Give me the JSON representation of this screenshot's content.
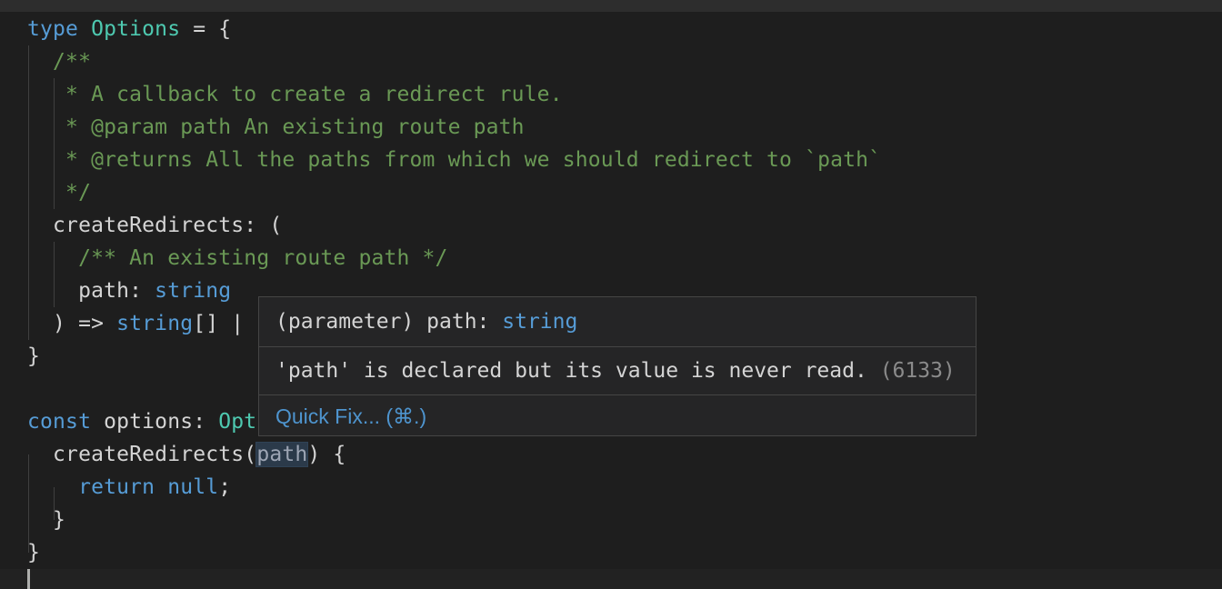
{
  "lines": [
    {
      "tokens": [
        {
          "t": "type ",
          "c": "kw"
        },
        {
          "t": "Options",
          "c": "ty"
        },
        {
          "t": " = {",
          "c": "pl"
        }
      ]
    },
    {
      "tokens": [
        {
          "t": "  /**",
          "c": "cm"
        }
      ]
    },
    {
      "tokens": [
        {
          "t": "   * A callback to create a redirect rule.",
          "c": "cm"
        }
      ]
    },
    {
      "tokens": [
        {
          "t": "   * @param path An existing route path",
          "c": "cm"
        }
      ]
    },
    {
      "tokens": [
        {
          "t": "   * @returns All the paths from which we should redirect to `path`",
          "c": "cm"
        }
      ]
    },
    {
      "tokens": [
        {
          "t": "   */",
          "c": "cm"
        }
      ]
    },
    {
      "tokens": [
        {
          "t": "  createRedirects: (",
          "c": "pl"
        }
      ]
    },
    {
      "tokens": [
        {
          "t": "    ",
          "c": "pl"
        },
        {
          "t": "/** An existing route path */",
          "c": "cm"
        }
      ]
    },
    {
      "tokens": [
        {
          "t": "    path: ",
          "c": "pl"
        },
        {
          "t": "string",
          "c": "kw"
        }
      ]
    },
    {
      "tokens": [
        {
          "t": "  ) => ",
          "c": "pl"
        },
        {
          "t": "string",
          "c": "kw"
        },
        {
          "t": "[] |",
          "c": "pl"
        }
      ]
    },
    {
      "tokens": [
        {
          "t": "}",
          "c": "pl"
        }
      ]
    },
    {
      "tokens": []
    },
    {
      "tokens": [
        {
          "t": "const ",
          "c": "kw"
        },
        {
          "t": "options: ",
          "c": "pl"
        },
        {
          "t": "Opt",
          "c": "ty"
        }
      ]
    },
    {
      "tokens": [
        {
          "t": "  createRedirects(",
          "c": "pl"
        },
        {
          "t": "path",
          "c": "dim hl"
        },
        {
          "t": ") {",
          "c": "pl"
        }
      ]
    },
    {
      "tokens": [
        {
          "t": "    ",
          "c": "pl"
        },
        {
          "t": "return null",
          "c": "kw"
        },
        {
          "t": ";",
          "c": "pl"
        }
      ]
    },
    {
      "tokens": [
        {
          "t": "  }",
          "c": "pl"
        }
      ]
    },
    {
      "tokens": [
        {
          "t": "}",
          "c": "pl"
        }
      ]
    },
    {
      "tokens": []
    }
  ],
  "hover": {
    "signature_prefix": "(parameter) path: ",
    "signature_type": "string",
    "message": "'path' is declared but its value is never read.",
    "code": "(6133)",
    "action": "Quick Fix... (⌘.)"
  }
}
